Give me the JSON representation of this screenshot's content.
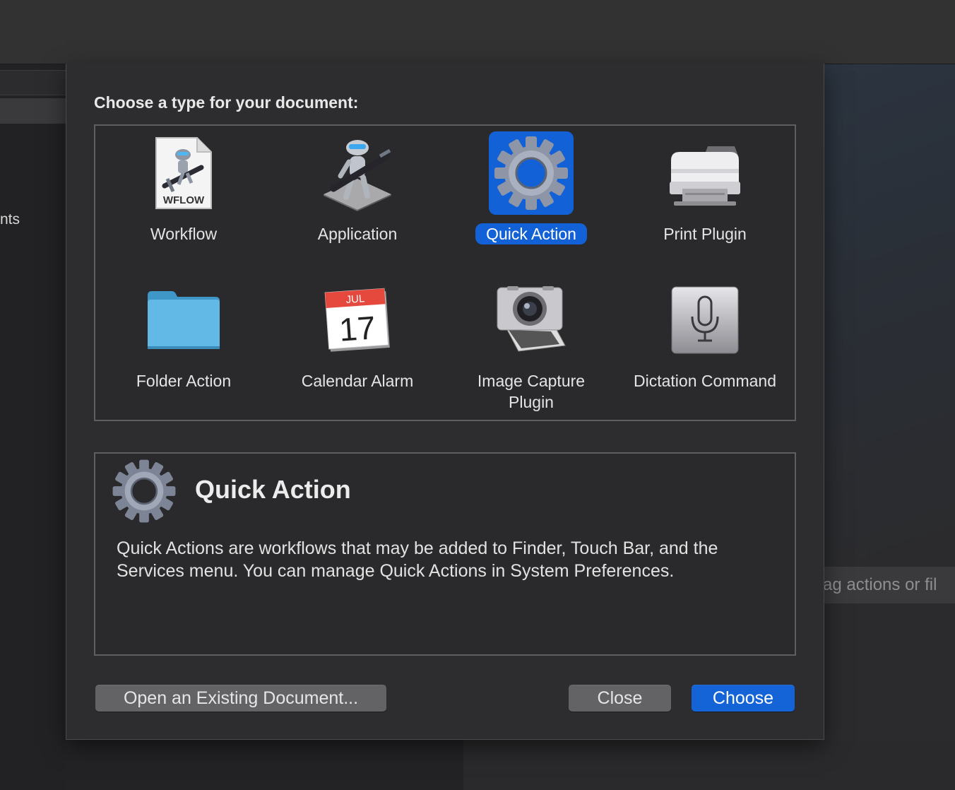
{
  "background": {
    "sidebar_partial_text": "nts",
    "drag_hint_text": "ag actions or fil"
  },
  "dialog": {
    "prompt": "Choose a type for your document:",
    "selected": "Quick Action",
    "types": [
      {
        "label": "Workflow",
        "icon": "workflow-document-icon",
        "icon_text": "WFLOW"
      },
      {
        "label": "Application",
        "icon": "automator-application-icon"
      },
      {
        "label": "Quick Action",
        "icon": "gear-icon"
      },
      {
        "label": "Print Plugin",
        "icon": "printer-icon"
      },
      {
        "label": "Folder Action",
        "icon": "folder-icon"
      },
      {
        "label": "Calendar Alarm",
        "icon": "calendar-icon",
        "icon_month": "JUL",
        "icon_day": "17"
      },
      {
        "label": "Image Capture Plugin",
        "icon": "camera-icon"
      },
      {
        "label": "Dictation Command",
        "icon": "microphone-icon"
      }
    ],
    "description": {
      "title": "Quick Action",
      "text": "Quick Actions are workflows that may be added to Finder, Touch Bar, and the Services menu. You can manage Quick Actions in System Preferences."
    },
    "buttons": {
      "open": "Open an Existing Document...",
      "close": "Close",
      "choose": "Choose"
    }
  },
  "colors": {
    "accent": "#1261d6",
    "sheet_bg": "#2d2d2f",
    "window_bg": "#232326",
    "border": "#5e5e60"
  }
}
